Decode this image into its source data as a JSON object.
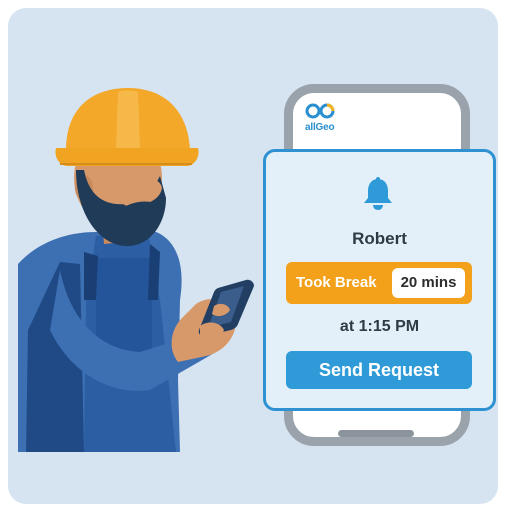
{
  "brand": {
    "logo_text": "allGeo",
    "logo_color": "#2a8fd0"
  },
  "notification": {
    "icon": "bell-icon",
    "employee_name": "Robert",
    "status_label": "Took Break",
    "duration": "20 mins",
    "time_text": "at 1:15 PM",
    "action_label": "Send Request"
  },
  "colors": {
    "background": "#d6e3f1",
    "accent_blue": "#2e9ad8",
    "status_orange": "#f3a11b",
    "hard_hat": "#f3a82a",
    "phone_frame": "#9aa3ab"
  },
  "illustration": {
    "subject": "construction worker with hard hat using smartphone"
  }
}
